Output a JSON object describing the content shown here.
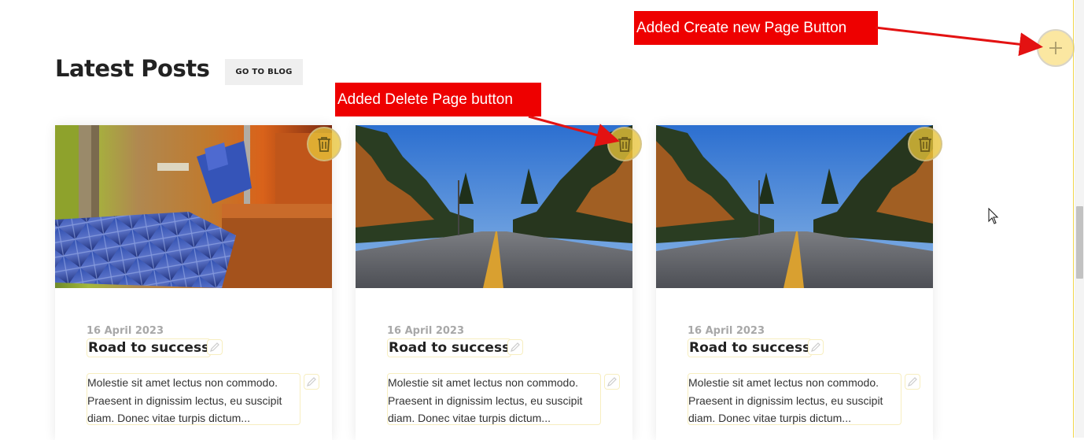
{
  "section": {
    "title": "Latest Posts",
    "go_to_blog_label": "GO TO BLOG"
  },
  "posts": [
    {
      "image": "bedroom-photo",
      "date": "16 April 2023",
      "title": "Road to success",
      "excerpt": "Molestie sit amet lectus non commodo. Praesent in dignissim lectus, eu suscipit diam. Donec vitae turpis dictum..."
    },
    {
      "image": "autumn-road-photo",
      "date": "16 April 2023",
      "title": "Road to success",
      "excerpt": "Molestie sit amet lectus non commodo. Praesent in dignissim lectus, eu suscipit diam. Donec vitae turpis dictum..."
    },
    {
      "image": "autumn-road-photo",
      "date": "16 April 2023",
      "title": "Road to success",
      "excerpt": "Molestie sit amet lectus non commodo. Praesent in dignissim lectus, eu suscipit diam. Donec vitae turpis dictum..."
    }
  ],
  "annotations": {
    "create_page": "Added Create new Page Button",
    "delete_page": "Added Delete Page button"
  },
  "icons": {
    "delete": "trash-icon",
    "create": "plus-icon",
    "edit": "pencil-icon",
    "cursor": "mouse-pointer-icon"
  },
  "colors": {
    "accent_yellow": "#e8c43a",
    "callout_red": "#ee0000",
    "create_button_bg": "#fbe7a1",
    "outline_yellow": "#f7eec0"
  }
}
